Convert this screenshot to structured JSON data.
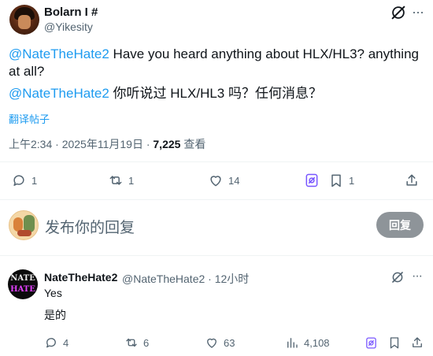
{
  "post": {
    "author_name": "Bolarn I #",
    "author_handle": "@Yikesity",
    "text_mention": "@NateTheHate2",
    "text_body": " Have you heard anything about HLX/HL3? anything at all?",
    "translated_mention": "@NateTheHate2",
    "translated_body": " 你听说过 HLX/HL3 吗？任何消息？",
    "translate_link": "翻译帖子",
    "timestamp": "上午2:34 · 2025年11月19日 · ",
    "views_count": "7,225",
    "views_label": " 查看",
    "actions": {
      "replies": "1",
      "reposts": "1",
      "likes": "14",
      "bookmarks": "1"
    }
  },
  "composer": {
    "placeholder": "发布你的回复",
    "button_label": "回复"
  },
  "reply": {
    "author_name": "NateTheHate2",
    "meta": "@NateTheHate2 · 12小时",
    "text": "Yes",
    "translated_text": "是的",
    "actions": {
      "replies": "4",
      "reposts": "6",
      "likes": "63",
      "views": "4,108"
    }
  },
  "icons": {
    "more": "more-icon",
    "grok": "grok-icon",
    "reply": "reply-icon",
    "repost": "repost-icon",
    "like": "like-icon",
    "views": "views-icon",
    "bookmark": "bookmark-icon",
    "share": "share-icon"
  },
  "colors": {
    "accent": "#1d9bf0",
    "secondary_text": "#536471",
    "primary_text": "#0f1419",
    "button_disabled": "#8e9499",
    "grok_purple": "#7856ff"
  }
}
